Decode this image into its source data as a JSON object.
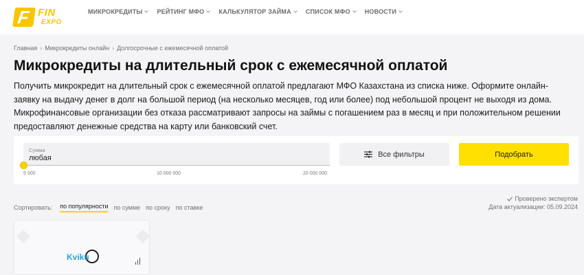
{
  "logo": {
    "mark": "F",
    "fin": "FIN",
    "expo": "EXPO"
  },
  "nav": [
    {
      "label": "МИКРОКРЕДИТЫ"
    },
    {
      "label": "РЕЙТИНГ МФО"
    },
    {
      "label": "КАЛЬКУЛЯТОР ЗАЙМА"
    },
    {
      "label": "СПИСОК МФО"
    },
    {
      "label": "НОВОСТИ"
    }
  ],
  "breadcrumb": [
    "Главная",
    "Микрокредиты онлайн",
    "Долгосрочные с ежемесячной оплатой"
  ],
  "title": "Микрокредиты на длительный срок с ежемесячной оплатой",
  "description": "Получить микрокредит на длительный срок с ежемесячной оплатой предлагают МФО Казахстана из списка ниже. Оформите онлайн-заявку на выдачу денег в долг на большой период (на несколько месяцев, год или более) под небольшой процент не выходя из дома. Микрофинансовые организации без отказа рассматривают запросы на займы с погашением раз в месяц и при положительном решении предоставляют денежные средства на карту или банковский счет.",
  "filter": {
    "sum_label": "Сумма",
    "sum_value": "любая",
    "slider_fraction": 0.0,
    "ticks": [
      "5 000",
      "10 000 000",
      "20 000 000"
    ],
    "filters_button": "Все фильтры",
    "pick_button": "Подобрать"
  },
  "sort": {
    "label": "Сортировать:",
    "options": [
      "по популярности",
      "по сумме",
      "по сроку",
      "по ставке"
    ],
    "active": "по популярности"
  },
  "expert": {
    "checked": "Проверено экспертом",
    "date": "Дата актуализации: 05.09.2024"
  },
  "card": {
    "brand_a": "Kvik",
    "brand_b": "u"
  },
  "colors": {
    "accent": "#ffe000",
    "logo": "#f7c600"
  }
}
